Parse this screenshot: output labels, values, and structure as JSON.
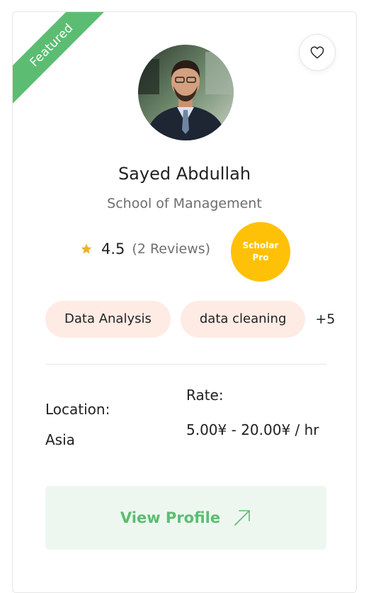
{
  "ribbon": {
    "label": "Featured"
  },
  "favorite": {
    "icon": "heart-icon"
  },
  "profile": {
    "name": "Sayed Abdullah",
    "school": "School of Management",
    "rating": "4.5",
    "reviews": "(2 Reviews)",
    "badge_line1": "Scholar",
    "badge_line2": "Pro"
  },
  "tags": {
    "items": [
      "Data Analysis",
      "data cleaning"
    ],
    "more": "+5"
  },
  "details": {
    "location_label": "Location:",
    "location_value": "Asia",
    "rate_label": "Rate:",
    "rate_value": "5.00¥ - 20.00¥ / hr"
  },
  "cta": {
    "label": "View Profile",
    "icon": "arrow-up-right-icon"
  },
  "colors": {
    "accent": "#5cbd72",
    "badge": "#ffc107",
    "tag_bg": "#fdebe4",
    "button_bg": "#edf7ef",
    "star": "#e8b52f"
  }
}
